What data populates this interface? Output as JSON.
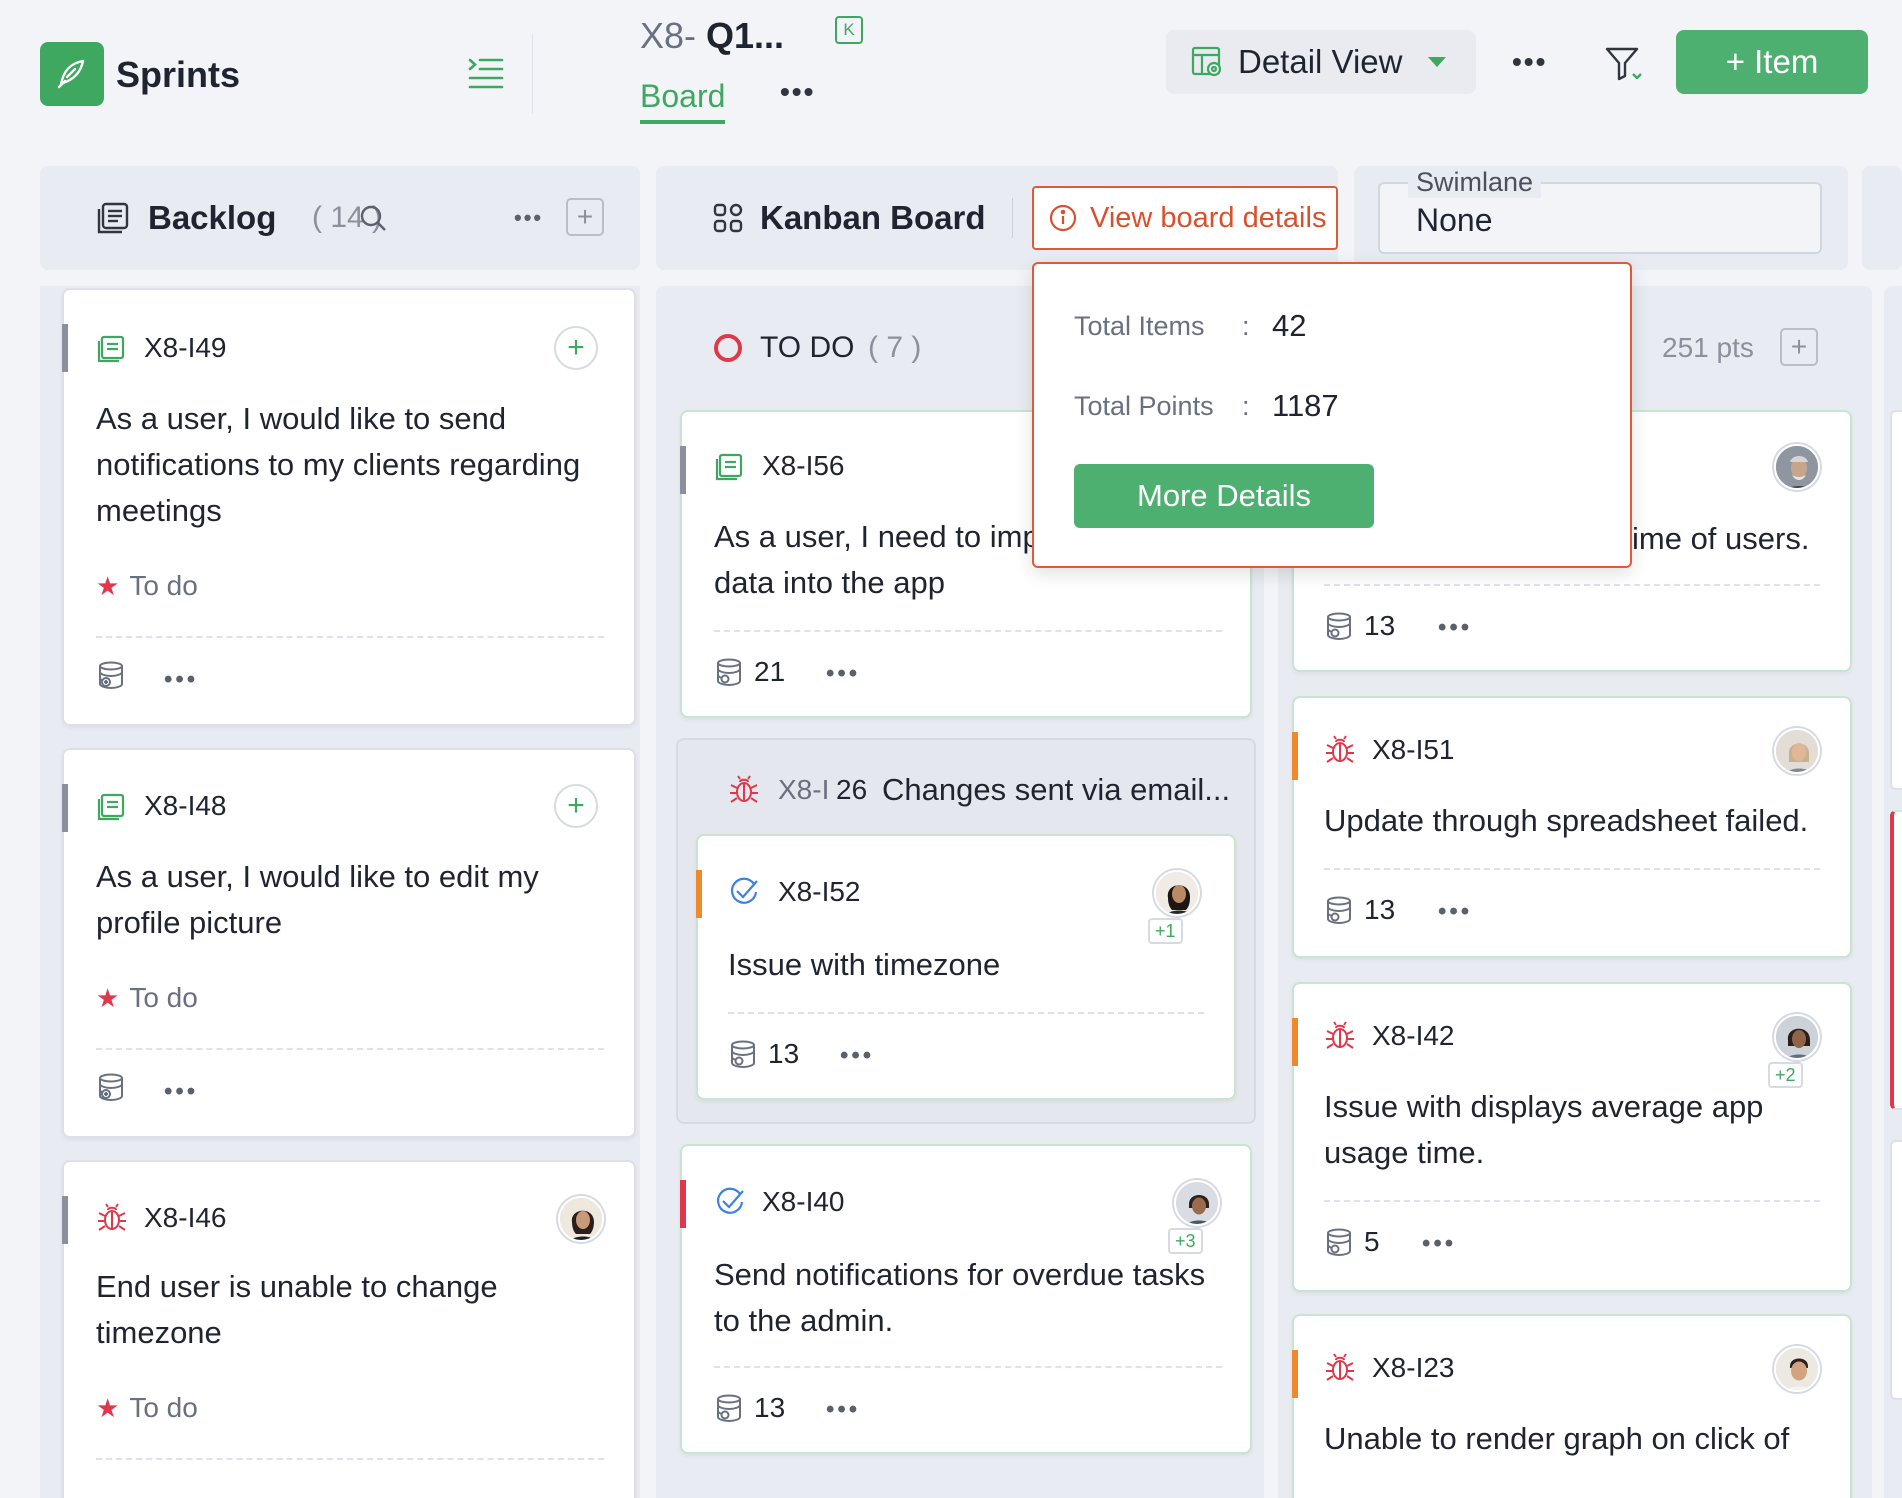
{
  "app": {
    "title": "Sprints"
  },
  "project": {
    "key": "X8-",
    "name": "Q1...",
    "badge": "K",
    "active_tab": "Board"
  },
  "toolbar": {
    "view_label": "Detail View",
    "add_item_label": "+ Item"
  },
  "backlog": {
    "title": "Backlog",
    "count": "( 14 )",
    "cards": [
      {
        "id": "X8-I49",
        "title_lines": [
          "As a user, I would like to send",
          "notifications to my clients regarding",
          "meetings"
        ],
        "status": "To do"
      },
      {
        "id": "X8-I48",
        "title_lines": [
          "As a user, I would like to edit my",
          "profile picture"
        ],
        "status": "To do"
      },
      {
        "id": "X8-I46",
        "title_lines": [
          "End user is unable to change",
          "timezone"
        ],
        "status": "To do"
      }
    ]
  },
  "kanban": {
    "title": "Kanban Board",
    "view_details_label": "View board details"
  },
  "swimlane": {
    "label": "Swimlane",
    "value": "None"
  },
  "popover": {
    "total_items_label": "Total Items",
    "total_items": "42",
    "total_points_label": "Total Points",
    "total_points": "1187",
    "colon": ":",
    "more_details_label": "More Details"
  },
  "todo": {
    "title": "TO DO",
    "count": "( 7 )",
    "cards": [
      {
        "id": "X8-I56",
        "title_lines": [
          "As a user, I need to imp",
          "data into the app"
        ],
        "points": "21"
      },
      {
        "group_id_prefix": "X8-I",
        "group_id_num": "26",
        "group_title": "Changes sent via email..."
      },
      {
        "id": "X8-I52",
        "title_lines": [
          "Issue with timezone"
        ],
        "points": "13",
        "avatar_extra": "+1"
      },
      {
        "id": "X8-I40",
        "title_lines": [
          "Send notifications for overdue tasks",
          "to the admin."
        ],
        "points": "13",
        "avatar_extra": "+3"
      }
    ]
  },
  "col3": {
    "points_label": "251 pts",
    "cards": [
      {
        "title_lines": [
          "ime of users."
        ],
        "points": "13"
      },
      {
        "id": "X8-I51",
        "title_lines": [
          "Update through spreadsheet failed."
        ],
        "points": "13"
      },
      {
        "id": "X8-I42",
        "title_lines": [
          "Issue with displays average app",
          "usage time."
        ],
        "points": "5",
        "avatar_extra": "+2"
      },
      {
        "id": "X8-I23",
        "title_lines": [
          "Unable to render graph on click of"
        ]
      }
    ]
  },
  "colors": {
    "accent": "#3ea860",
    "danger": "#e0384b",
    "warning": "#e05a3a",
    "orange_bar": "#ef8a2c"
  },
  "icons": [
    "quill-icon",
    "collapse-icon",
    "detail-view-icon",
    "filter-icon",
    "backlog-icon",
    "search-icon",
    "kanban-icon",
    "info-icon",
    "story-icon",
    "bug-icon",
    "task-icon",
    "points-icon",
    "star-icon"
  ]
}
